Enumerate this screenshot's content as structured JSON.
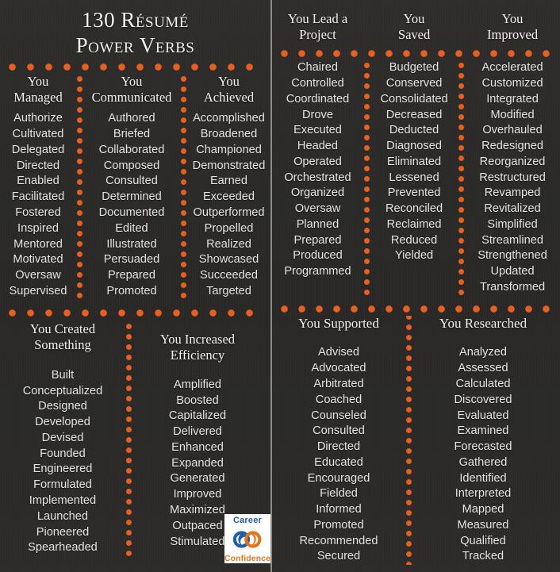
{
  "title": {
    "line1": "130 Résumé",
    "line2": "Power Verbs"
  },
  "colors": {
    "background": "#2b2a28",
    "accent_orange": "#e8601f",
    "text": "#e6e5e2",
    "divider": "#8c8c8a",
    "logo_blue": "#1f5fa9",
    "logo_orange": "#e2761b"
  },
  "logo": {
    "top_text": "Career",
    "bottom_text": "Confidence"
  },
  "sections": {
    "top_left": {
      "columns": [
        {
          "heading_line1": "You",
          "heading_line2": "Managed",
          "words": [
            "Authorize",
            "Cultivated",
            "Delegated",
            "Directed",
            "Enabled",
            "Facilitated",
            "Fostered",
            "Inspired",
            "Mentored",
            "Motivated",
            "Oversaw",
            "Supervised"
          ]
        },
        {
          "heading_line1": "You",
          "heading_line2": "Communicated",
          "words": [
            "Authored",
            "Briefed",
            "Collaborated",
            "Composed",
            "Consulted",
            "Determined",
            "Documented",
            "Edited",
            "Illustrated",
            "Persuaded",
            "Prepared",
            "Promoted"
          ]
        },
        {
          "heading_line1": "You",
          "heading_line2": "Achieved",
          "words": [
            "Accomplished",
            "Broadened",
            "Championed",
            "Demonstrated",
            "Earned",
            "Exceeded",
            "Outperformed",
            "Propelled",
            "Realized",
            "Showcased",
            "Succeeded",
            "Targeted"
          ]
        }
      ]
    },
    "bottom_left": {
      "columns": [
        {
          "heading_line1": "You Created",
          "heading_line2": "Something",
          "words": [
            "Built",
            "Conceptualized",
            "Designed",
            "Developed",
            "Devised",
            "Founded",
            "Engineered",
            "Formulated",
            "Implemented",
            "Launched",
            "Pioneered",
            "Spearheaded"
          ]
        },
        {
          "heading_line1": "You Increased",
          "heading_line2": "Efficiency",
          "words": [
            "Amplified",
            "Boosted",
            "Capitalized",
            "Delivered",
            "Enhanced",
            "Expanded",
            "Generated",
            "Improved",
            "Maximized",
            "Outpaced",
            "Stimulated"
          ]
        }
      ]
    },
    "top_right": {
      "columns": [
        {
          "heading_line1": "You Lead a",
          "heading_line2": "Project",
          "words": [
            "Chaired",
            "Controlled",
            "Coordinated",
            "Drove",
            "Executed",
            "Headed",
            "Operated",
            "Orchestrated",
            "Organized",
            "Oversaw",
            "Planned",
            "Prepared",
            "Produced",
            "Programmed"
          ]
        },
        {
          "heading_line1": "You",
          "heading_line2": "Saved",
          "words": [
            "Budgeted",
            "Conserved",
            "Consolidated",
            "Decreased",
            "Deducted",
            "Diagnosed",
            "Eliminated",
            "Lessened",
            "Prevented",
            "Reconciled",
            "Reclaimed",
            "Reduced",
            "Yielded"
          ]
        },
        {
          "heading_line1": "You",
          "heading_line2": "Improved",
          "words": [
            "Accelerated",
            "Customized",
            "Integrated",
            "Modified",
            "Overhauled",
            "Redesigned",
            "Reorganized",
            "Restructured",
            "Revamped",
            "Revitalized",
            "Simplified",
            "Streamlined",
            "Strengthened",
            "Updated",
            "Transformed"
          ]
        }
      ]
    },
    "bottom_right": {
      "columns": [
        {
          "heading_line1": "You Supported",
          "heading_line2": "",
          "words": [
            "Advised",
            "Advocated",
            "Arbitrated",
            "Coached",
            "Counseled",
            "Consulted",
            "Directed",
            "Educated",
            "Encouraged",
            "Fielded",
            "Informed",
            "Promoted",
            "Recommended",
            "Secured"
          ]
        },
        {
          "heading_line1": "You Researched",
          "heading_line2": "",
          "words": [
            "Analyzed",
            "Assessed",
            "Calculated",
            "Discovered",
            "Evaluated",
            "Examined",
            "Forecasted",
            "Gathered",
            "Identified",
            "Interpreted",
            "Mapped",
            "Measured",
            "Qualified",
            "Tracked"
          ]
        }
      ]
    }
  }
}
